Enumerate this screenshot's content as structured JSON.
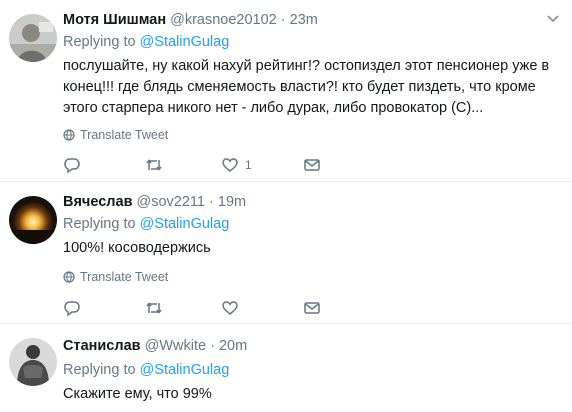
{
  "tweets": [
    {
      "name": "Мотя Шишман",
      "handle": "@krasnoe20102",
      "separator": "·",
      "time": "23m",
      "replying_prefix": "Replying to",
      "replying_to": "@StalinGulag",
      "text": "послушайте, ну какой нахуй рейтинг!? остопиздел этот пенсионер уже в конец!!! где блядь сменяемость власти?! кто будет пиздеть, что кроме этого старпера никого нет - либо дурак, либо провокатор (С)...",
      "translate_label": "Translate Tweet",
      "like_count": "1",
      "avatar_icon": "user-avatar"
    },
    {
      "name": "Вячеслав",
      "handle": "@sov2211",
      "separator": "·",
      "time": "19m",
      "replying_prefix": "Replying to",
      "replying_to": "@StalinGulag",
      "text": "100%! косоводержись",
      "translate_label": "Translate Tweet",
      "like_count": "",
      "avatar_icon": "sunset-avatar"
    },
    {
      "name": "Станислав",
      "handle": "@Wwkite",
      "separator": "·",
      "time": "20m",
      "replying_prefix": "Replying to",
      "replying_to": "@StalinGulag",
      "text": "Скажите ему,  что 99%",
      "avatar_icon": "athlete-avatar"
    }
  ],
  "colors": {
    "accent": "#1da1f2",
    "muted": "#657786",
    "divider": "#e6ecf0"
  }
}
